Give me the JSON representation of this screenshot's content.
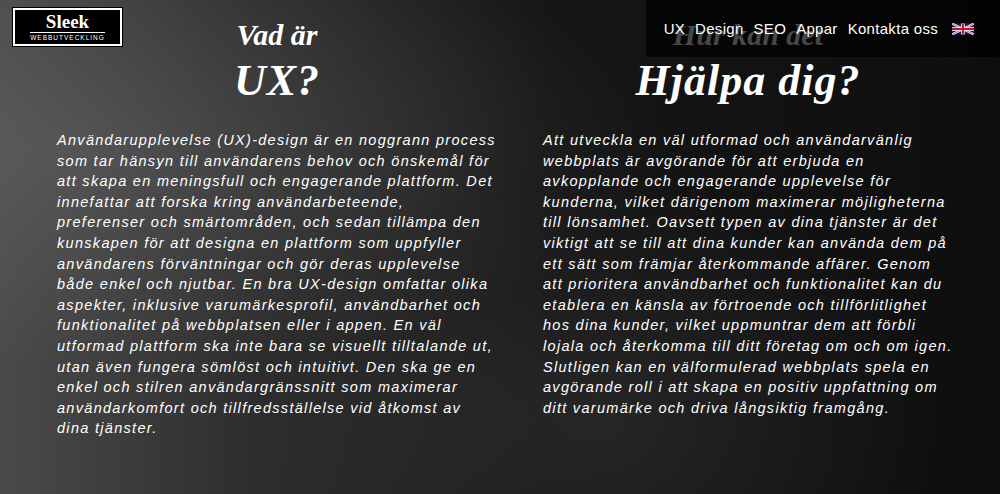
{
  "logo": {
    "name": "Sleek",
    "tagline": "WEBBUTVECKLING"
  },
  "nav": {
    "items": [
      "UX",
      "Design",
      "SEO",
      "Appar",
      "Kontakta oss"
    ]
  },
  "sections": [
    {
      "kicker": "Vad är",
      "title": "UX?",
      "body": "Användarupplevelse (UX)-design är en noggrann process som tar hänsyn till användarens behov och önskemål för att skapa en meningsfull och engagerande plattform. Det innefattar att forska kring användarbeteende, preferenser och smärtområden, och sedan tillämpa den kunskapen för att designa en plattform som uppfyller användarens förväntningar och gör deras upplevelse både enkel och njutbar. En bra UX-design omfattar olika aspekter, inklusive varumärkesprofil, användbarhet och funktionalitet på webbplatsen eller i appen. En väl utformad plattform ska inte bara se visuellt tilltalande ut, utan även fungera sömlöst och intuitivt. Den ska ge en enkel och stilren användargränssnitt som maximerar användarkomfort och tillfredsställelse vid åtkomst av dina tjänster."
    },
    {
      "kicker": "Hur kan det",
      "title": "Hjälpa dig?",
      "body": "Att utveckla en väl utformad och användarvänlig webbplats är avgörande för att erbjuda en avkopplande och engagerande upplevelse för kunderna, vilket därigenom maximerar möjligheterna till lönsamhet. Oavsett typen av dina tjänster är det viktigt att se till att dina kunder kan använda dem på ett sätt som främjar återkommande affärer. Genom att prioritera användbarhet och funktionalitet kan du etablera en känsla av förtroende och tillförlitlighet hos dina kunder, vilket uppmuntrar dem att förbli lojala och återkomma till ditt företag om och om igen. Slutligen kan en välformulerad webbplats spela en avgörande roll i att skapa en positiv uppfattning om ditt varumärke och driva långsiktig framgång."
    }
  ]
}
